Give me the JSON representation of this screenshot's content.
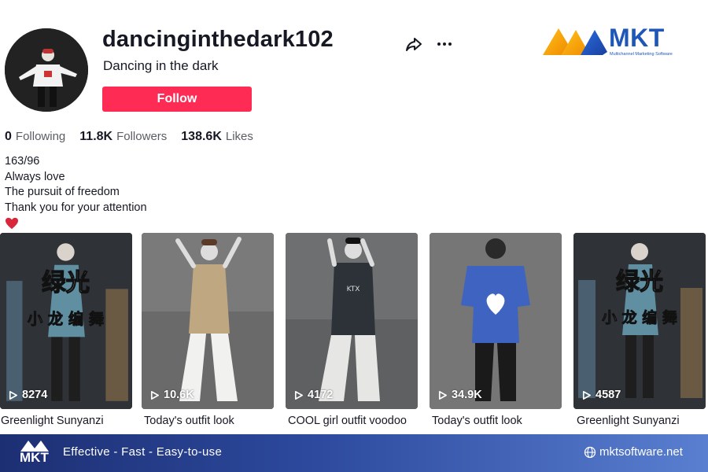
{
  "profile": {
    "username": "dancinginthedark102",
    "nickname": "Dancing in the dark",
    "follow_label": "Follow"
  },
  "stats": [
    {
      "value": "0",
      "label": "Following"
    },
    {
      "value": "11.8K",
      "label": "Followers"
    },
    {
      "value": "138.6K",
      "label": "Likes"
    }
  ],
  "bio": {
    "lines": [
      "163/96",
      "Always love",
      "The pursuit of freedom",
      "Thank you for your attention"
    ],
    "emoji": "heart-icon"
  },
  "videos": [
    {
      "views": "8274",
      "caption": "Greenlight Sunyanzi",
      "overlay_title": "绿光",
      "overlay_sub": "小 龙 编 舞"
    },
    {
      "views": "10.6K",
      "caption": "Today's outfit look"
    },
    {
      "views": "4172",
      "caption": "COOL girl outfit voodoo"
    },
    {
      "views": "34.9K",
      "caption": "Today's outfit look"
    },
    {
      "views": "4587",
      "caption": "Greenlight Sunyanzi",
      "overlay_title": "绿光",
      "overlay_sub": "小 龙 编 舞"
    }
  ],
  "branding": {
    "logo_text": "MKT",
    "logo_tagline": "Multichannel Marketing Software",
    "footer_slogan": "Effective - Fast - Easy-to-use",
    "footer_site": "mktsoftware.net",
    "accent": "#fe2c55",
    "brand_blue": "#1f57b6"
  }
}
